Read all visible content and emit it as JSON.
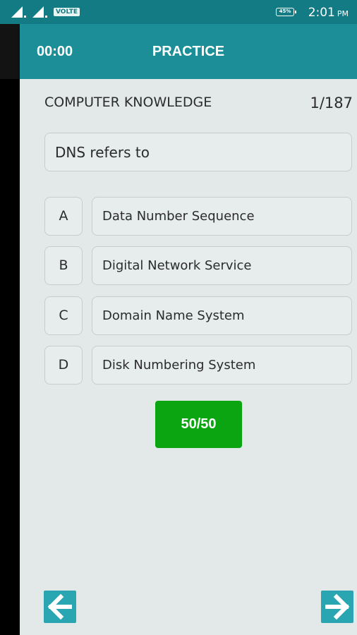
{
  "status_bar": {
    "network_label": "VOLTE",
    "battery_percent": "45%",
    "time": "2:01",
    "ampm": "PM"
  },
  "app_bar": {
    "timer": "00:00",
    "title": "PRACTICE"
  },
  "quiz": {
    "category": "COMPUTER KNOWLEDGE",
    "counter": "1/187",
    "question": "DNS refers to",
    "options": [
      {
        "letter": "A",
        "text": "Data Number Sequence"
      },
      {
        "letter": "B",
        "text": "Digital Network Service"
      },
      {
        "letter": "C",
        "text": "Domain Name System"
      },
      {
        "letter": "D",
        "text": "Disk Numbering System"
      }
    ],
    "lifeline_label": "50/50"
  },
  "navigation": {
    "prev_icon": "arrow-left-icon",
    "next_icon": "arrow-right-icon"
  },
  "colors": {
    "app_bar": "#1b8e97",
    "status_bar": "#137b84",
    "lifeline": "#0ca512",
    "nav_button": "#2aa6b3",
    "background": "#e3e9e9"
  }
}
